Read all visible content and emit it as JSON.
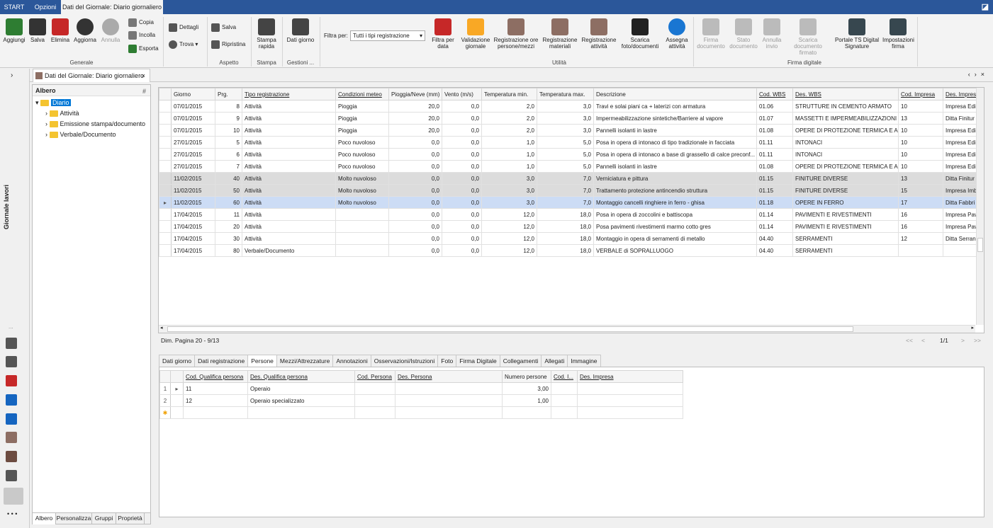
{
  "top_tabs": {
    "start": "START",
    "opzioni": "Opzioni",
    "dati": "Dati del Giornale: Diario giornaliero"
  },
  "ribbon": {
    "aggiungi": "Aggiungi",
    "salva": "Salva",
    "elimina": "Elimina",
    "aggiorna": "Aggiorna",
    "annulla": "Annulla",
    "copia": "Copia",
    "incolla": "Incolla",
    "esporta": "Esporta",
    "group_generale": "Generale",
    "dettagli": "Dettagli",
    "trova": "Trova",
    "salva_aspetto": "Salva",
    "ripristina": "Ripristina",
    "group_aspetto": "Aspetto",
    "stampa_rapida": "Stampa rapida",
    "group_stampa": "Stampa",
    "dati_giorno": "Dati giorno",
    "group_gestioni": "Gestioni ...",
    "filtra_per": "Filtra per:",
    "filter_value": "Tutti i tipi registrazione",
    "filtra_data": "Filtra per data",
    "validazione": "Validazione giornale",
    "reg_ore": "Registrazione ore persone/mezzi",
    "reg_materiali": "Registrazione materiali",
    "reg_attivita": "Registrazione attività",
    "scarica_foto": "Scarica foto/documenti",
    "assegna": "Assegna attività",
    "group_utilita": "Utilità",
    "firma_doc": "Firma documento",
    "stato_doc": "Stato documento",
    "annulla_invio": "Annulla invio",
    "scarica_firmato": "Scarica documento firmato",
    "portale": "Portale TS Digital Signature",
    "impostazioni_firma": "Impostazioni firma",
    "group_firma": "Firma digitale"
  },
  "side": {
    "vertical_label": "Giornale lavori",
    "dots": "...",
    "dots_bottom": "• • •"
  },
  "doc_tab": {
    "title": "Dati del Giornale: Diario giornaliero",
    "close": "×"
  },
  "tree": {
    "title": "Albero",
    "pin": "#",
    "root": "Diario",
    "children": [
      "Attività",
      "Emissione stampa/documento",
      "Verbale/Documento"
    ],
    "tabs": [
      "Albero",
      "Personalizza",
      "Gruppi",
      "Proprietà"
    ]
  },
  "grid": {
    "columns": [
      "Giorno",
      "Prg.",
      "Tipo registrazione",
      "Condizioni meteo",
      "Pioggia/Neve (mm)",
      "Vento (m/s)",
      "Temperatura min.",
      "Temperatura max.",
      "Descrizione",
      "Cod. WBS",
      "Des. WBS",
      "Cod. Impresa",
      "Des. Impresa"
    ],
    "rows": [
      [
        "07/01/2015",
        "8",
        "Attività",
        "Pioggia",
        "20,0",
        "0,0",
        "2,0",
        "3,0",
        "Travi e solai piani ca + laterizi con armatura",
        "01.06",
        "STRUTTURE IN CEMENTO ARMATO",
        "10",
        "Impresa Edi"
      ],
      [
        "07/01/2015",
        "9",
        "Attività",
        "Pioggia",
        "20,0",
        "0,0",
        "2,0",
        "3,0",
        "Impermeabilizzazione sintetiche/Barriere al vapore",
        "01.07",
        "MASSETTI E IMPERMEABILIZZAZIONI",
        "13",
        "Ditta Finitur"
      ],
      [
        "07/01/2015",
        "10",
        "Attività",
        "Pioggia",
        "20,0",
        "0,0",
        "2,0",
        "3,0",
        "Pannelli isolanti in lastre",
        "01.08",
        "OPERE DI PROTEZIONE TERMICA E A...",
        "10",
        "Impresa Edi"
      ],
      [
        "27/01/2015",
        "5",
        "Attività",
        "Poco nuvoloso",
        "0,0",
        "0,0",
        "1,0",
        "5,0",
        "Posa in opera di intonaco di tipo tradizionale in facciata",
        "01.11",
        "INTONACI",
        "10",
        "Impresa Edi"
      ],
      [
        "27/01/2015",
        "6",
        "Attività",
        "Poco nuvoloso",
        "0,0",
        "0,0",
        "1,0",
        "5,0",
        "Posa in opera di intonaco a base di grassello di calce preconf...",
        "01.11",
        "INTONACI",
        "10",
        "Impresa Edi"
      ],
      [
        "27/01/2015",
        "7",
        "Attività",
        "Poco nuvoloso",
        "0,0",
        "0,0",
        "1,0",
        "5,0",
        "Pannelli isolanti in lastre",
        "01.08",
        "OPERE DI PROTEZIONE TERMICA E A...",
        "10",
        "Impresa Edi"
      ],
      [
        "11/02/2015",
        "40",
        "Attività",
        "Molto nuvoloso",
        "0,0",
        "0,0",
        "3,0",
        "7,0",
        "Verniciatura e pittura",
        "01.15",
        "FINITURE DIVERSE",
        "13",
        "Ditta Finitur"
      ],
      [
        "11/02/2015",
        "50",
        "Attività",
        "Molto nuvoloso",
        "0,0",
        "0,0",
        "3,0",
        "7,0",
        "Trattamento protezione antincendio struttura",
        "01.15",
        "FINITURE DIVERSE",
        "15",
        "Impresa Imb"
      ],
      [
        "11/02/2015",
        "60",
        "Attività",
        "Molto nuvoloso",
        "0,0",
        "0,0",
        "3,0",
        "7,0",
        "Montaggio cancelli ringhiere in ferro - ghisa",
        "01.18",
        "OPERE IN FERRO",
        "17",
        "Ditta Fabbri"
      ],
      [
        "17/04/2015",
        "11",
        "Attività",
        "",
        "0,0",
        "0,0",
        "12,0",
        "18,0",
        "Posa in opera di zoccolini e battiscopa",
        "01.14",
        "PAVIMENTI E RIVESTIMENTI",
        "16",
        "Impresa Pav"
      ],
      [
        "17/04/2015",
        "20",
        "Attività",
        "",
        "0,0",
        "0,0",
        "12,0",
        "18,0",
        "Posa pavimenti rivestimenti marmo cotto gres",
        "01.14",
        "PAVIMENTI E RIVESTIMENTI",
        "16",
        "Impresa Pav"
      ],
      [
        "17/04/2015",
        "30",
        "Attività",
        "",
        "0,0",
        "0,0",
        "12,0",
        "18,0",
        "Montaggio in opera di serramenti di metallo",
        "04.40",
        "SERRAMENTI",
        "12",
        "Ditta Serran"
      ],
      [
        "17/04/2015",
        "80",
        "Verbale/Documento",
        "",
        "0,0",
        "0,0",
        "12,0",
        "18,0",
        "VERBALE di SOPRALLUOGO",
        "04.40",
        "SERRAMENTI",
        "",
        ""
      ]
    ],
    "current_row_marker": "▸",
    "page_info": "Dim. Pagina 20  - 9/13",
    "pager": {
      "first": "<<",
      "prev": "<",
      "page": "1/1",
      "next": ">",
      "last": ">>"
    }
  },
  "sub_tabs": [
    "Dati giorno",
    "Dati registrazione",
    "Persone",
    "Mezzi/Attrezzature",
    "Annotazioni",
    "Osservazioni/Istruzioni",
    "Foto",
    "Firma Digitale",
    "Collegamenti",
    "Allegati",
    "Immagine"
  ],
  "persone": {
    "columns": [
      "Cod. Qualifica persona",
      "Des. Qualifica persona",
      "Cod. Persona",
      "Des. Persona",
      "Numero persone",
      "Cod. I...",
      "Des. Impresa"
    ],
    "rows": [
      {
        "num": "1",
        "marker": "▸",
        "values": [
          "11",
          "Operaio",
          "",
          "",
          "3,00",
          "",
          ""
        ]
      },
      {
        "num": "2",
        "marker": "",
        "values": [
          "12",
          "Operaio specializzato",
          "",
          "",
          "1,00",
          "",
          ""
        ]
      }
    ],
    "new_row_marker": "✱"
  }
}
